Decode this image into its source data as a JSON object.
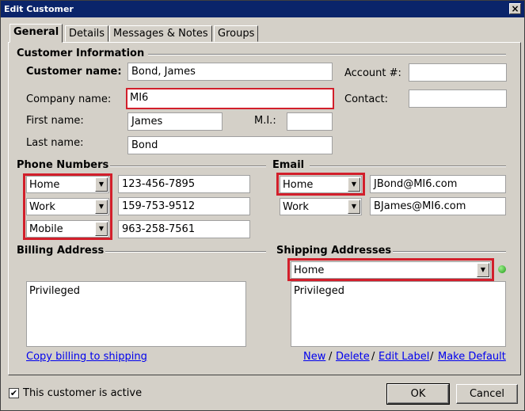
{
  "window": {
    "title": "Edit Customer",
    "close_glyph": "×"
  },
  "tabs": [
    {
      "label": "General",
      "active": true
    },
    {
      "label": "Details"
    },
    {
      "label": "Messages & Notes"
    },
    {
      "label": "Groups"
    }
  ],
  "customer_info": {
    "heading": "Customer Information",
    "customer_name_label": "Customer name:",
    "customer_name": "Bond, James",
    "account_label": "Account #:",
    "account": "",
    "company_label": "Company name:",
    "company": "MI6",
    "contact_label": "Contact:",
    "contact": "",
    "first_name_label": "First name:",
    "first_name": "James",
    "mi_label": "M.I.:",
    "mi": "",
    "last_name_label": "Last name:",
    "last_name": "Bond"
  },
  "phone": {
    "heading": "Phone Numbers",
    "rows": [
      {
        "type": "Home",
        "number": "123-456-7895"
      },
      {
        "type": "Work",
        "number": "159-753-9512"
      },
      {
        "type": "Mobile",
        "number": "963-258-7561"
      }
    ]
  },
  "email": {
    "heading": "Email",
    "rows": [
      {
        "type": "Home",
        "address": "JBond@MI6.com"
      },
      {
        "type": "Work",
        "address": "BJames@MI6.com"
      }
    ]
  },
  "billing": {
    "heading": "Billing Address",
    "address": "Privileged",
    "copy_link": "Copy billing to shipping"
  },
  "shipping": {
    "heading": "Shipping Addresses",
    "selected": "Home",
    "address": "Privileged",
    "links": {
      "new": "New",
      "delete": "Delete",
      "edit_label": "Edit Label",
      "make_default": "Make Default"
    },
    "separator": "/",
    "status_color": "#2aa31f"
  },
  "footer": {
    "active_label": "This customer is active",
    "active_checked": "✔",
    "ok_label": "OK",
    "cancel_label": "Cancel"
  },
  "colors": {
    "highlight": "#d21f2b",
    "link": "#0000ee",
    "titlebar": "#0a246a"
  },
  "icons": {
    "dropdown": "▼"
  }
}
